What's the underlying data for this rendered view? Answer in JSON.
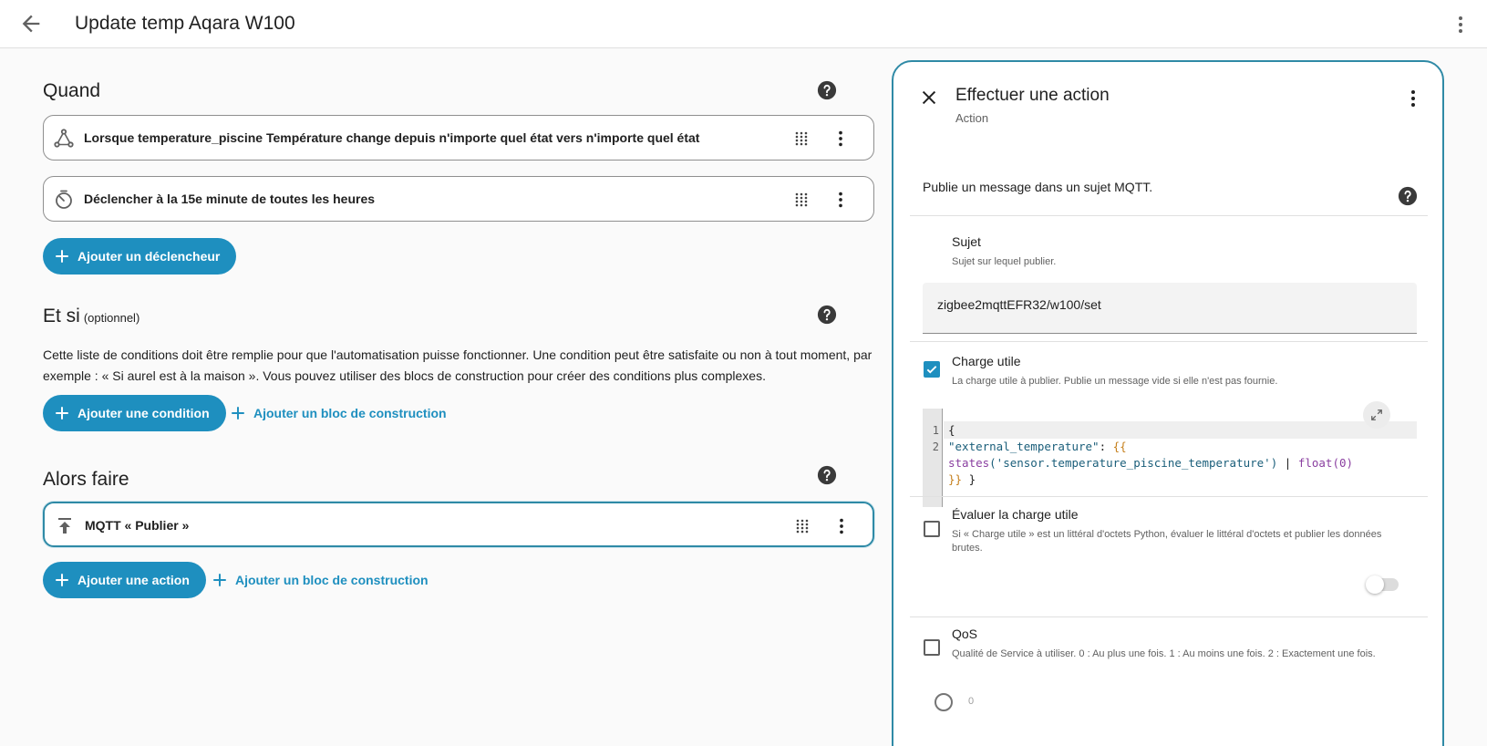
{
  "header": {
    "title": "Update temp Aqara W100"
  },
  "when": {
    "title": "Quand",
    "triggers": [
      {
        "label": "Lorsque temperature_piscine Température change depuis n'importe quel état vers n'importe quel état",
        "icon": "state-change-icon"
      },
      {
        "label": "Déclencher à la 15e minute de toutes les heures",
        "icon": "timer-icon"
      }
    ],
    "add_trigger": "Ajouter un déclencheur"
  },
  "and_if": {
    "title": "Et si",
    "optional": "(optionnel)",
    "description": "Cette liste de conditions doit être remplie pour que l'automatisation puisse fonctionner. Une condition peut être satisfaite ou non à tout moment, par exemple : « Si aurel est à la maison ». Vous pouvez utiliser des blocs de construction pour créer des conditions plus complexes.",
    "add_condition": "Ajouter une condition",
    "add_block": "Ajouter un bloc de construction"
  },
  "then_do": {
    "title": "Alors faire",
    "actions": [
      {
        "label": "MQTT « Publier »",
        "icon": "upload-icon"
      }
    ],
    "add_action": "Ajouter une action",
    "add_block": "Ajouter un bloc de construction"
  },
  "panel": {
    "title": "Effectuer une action",
    "subtitle": "Action",
    "intro": "Publie un message dans un sujet MQTT.",
    "topic": {
      "label": "Sujet",
      "hint": "Sujet sur lequel publier.",
      "value": "zigbee2mqttEFR32/w100/set"
    },
    "payload": {
      "label": "Charge utile",
      "hint": "La charge utile à publier. Publie un message vide si elle n'est pas fournie.",
      "checked": true,
      "line_numbers": [
        "1",
        "2"
      ],
      "code": {
        "line1": "{",
        "line2_key": "\"external_temperature\"",
        "line2_colon": ": ",
        "line2_tpl_open": "{{",
        "line3_fn": "states",
        "line3_arg": "('sensor.temperature_piscine_temperature')",
        "line3_pipe": " | ",
        "line3_filter": "float(0)",
        "line4_tpl_close": "}}",
        "line4_end": " }"
      }
    },
    "evaluate": {
      "label": "Évaluer la charge utile",
      "hint": "Si « Charge utile » est un littéral d'octets Python, évaluer le littéral d'octets et publier les données brutes.",
      "checked": false,
      "toggle_on": false
    },
    "qos": {
      "label": "QoS",
      "hint": "Qualité de Service à utiliser. 0 : Au plus une fois. 1 : Au moins une fois. 2 : Exactement une fois.",
      "checked": false,
      "radio_value": "0"
    }
  },
  "colors": {
    "accent": "#1e8fbf",
    "panel_border": "#2f8aa6",
    "template": "#c57f1b",
    "string": "#1a5e7a"
  }
}
